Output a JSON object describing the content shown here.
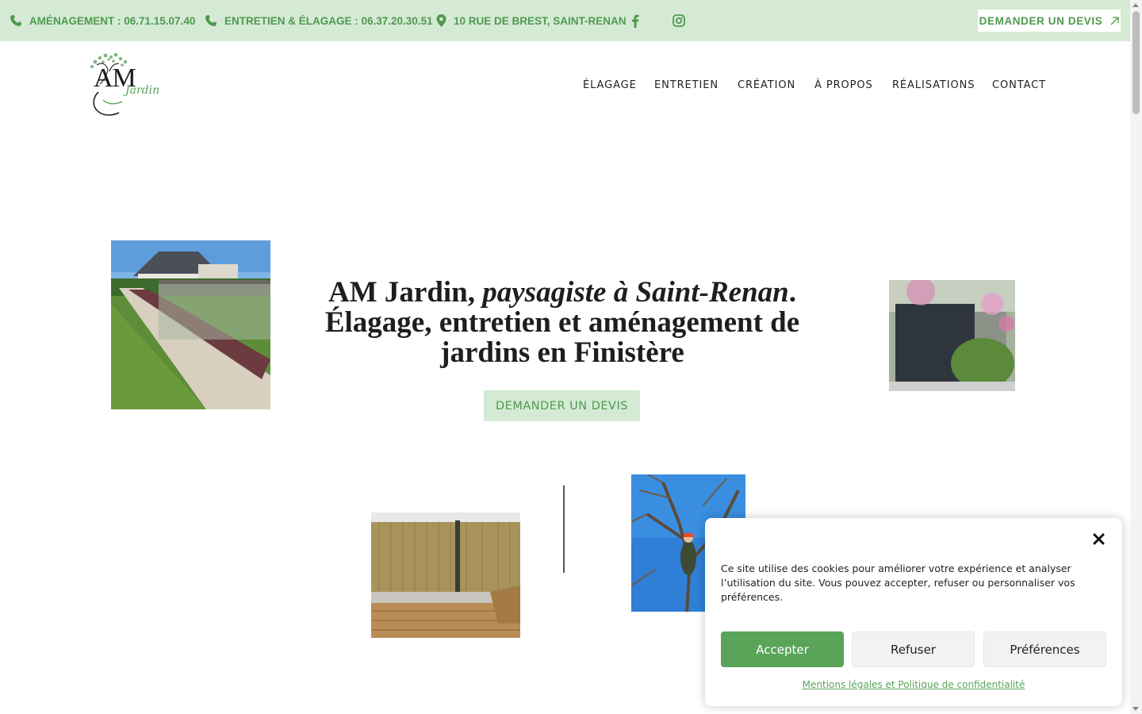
{
  "topbar": {
    "phone_amenagement": "AMÉNAGEMENT : 06.71.15.07.40",
    "phone_entretien": "ENTRETIEN & ÉLAGAGE : 06.37.20.30.51",
    "address": "10 RUE DE BREST, SAINT-RENAN",
    "social": [
      "facebook-icon",
      "instagram-icon"
    ],
    "devis_label": "DEMANDER UN DEVIS"
  },
  "logo": {
    "main": "AM",
    "sub": "Jardin"
  },
  "nav": {
    "items": [
      "ÉLAGAGE",
      "ENTRETIEN",
      "CRÉATION",
      "À PROPOS",
      "RÉALISATIONS",
      "CONTACT"
    ]
  },
  "hero": {
    "title_part1": "AM Jardin, ",
    "title_italic": "paysagiste à Saint-Renan",
    "title_part2": ".",
    "title_line2": "Élagage, entretien et aménagement de jardins en Finistère",
    "cta_label": "DEMANDER UN DEVIS"
  },
  "cookie": {
    "text": "Ce site utilise des cookies pour améliorer votre expérience et analyser l’utilisation du site. Vous pouvez accepter, refuser ou personnaliser vos préférences.",
    "accept": "Accepter",
    "refuse": "Refuser",
    "preferences": "Préférences",
    "link": "Mentions légales et Politique de confidentialité"
  },
  "colors": {
    "accent_green": "#4e9a4e",
    "topbar_bg": "#d5ead5",
    "accept_button": "#5aa45a"
  }
}
